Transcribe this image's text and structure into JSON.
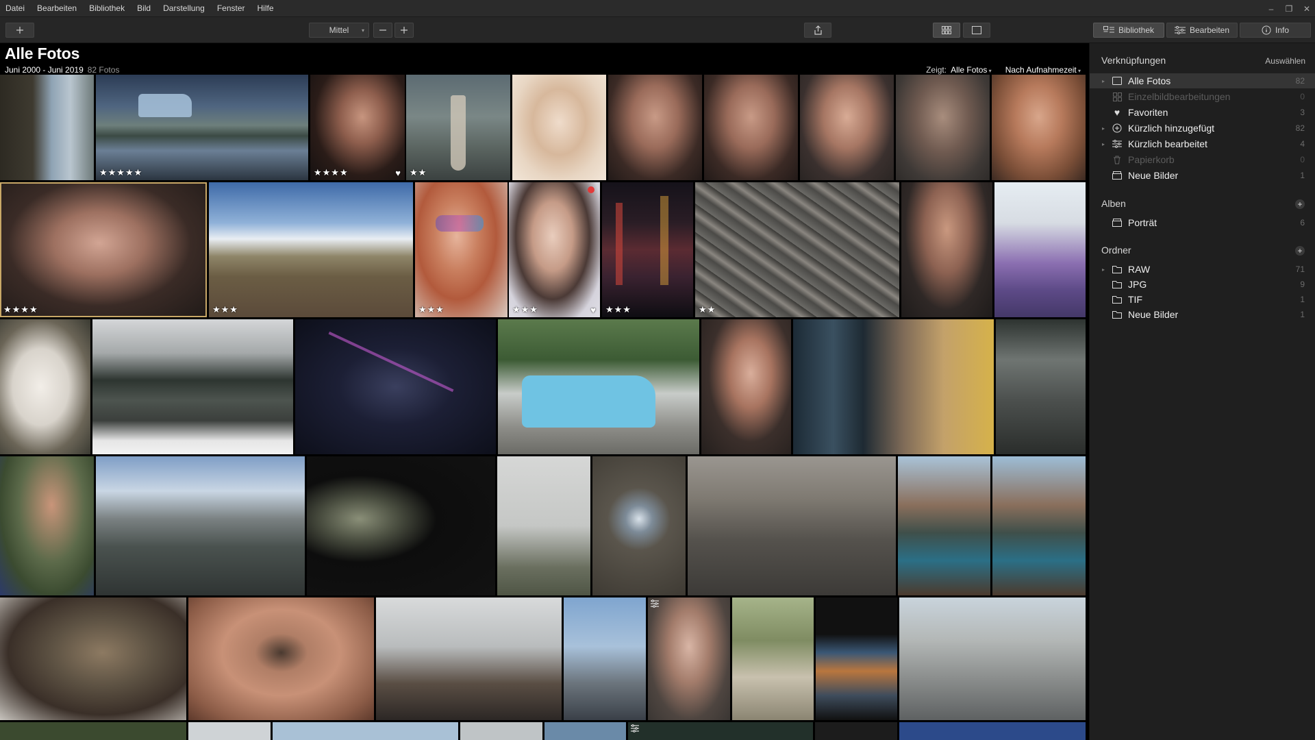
{
  "menu": [
    "Datei",
    "Bearbeiten",
    "Bibliothek",
    "Bild",
    "Darstellung",
    "Fenster",
    "Hilfe"
  ],
  "toolbar": {
    "size_select": "Mittel",
    "tab_library": "Bibliothek",
    "tab_edit": "Bearbeiten",
    "tab_info": "Info"
  },
  "header": {
    "title": "Alle Fotos",
    "date_range": "Juni 2000 - Juni 2019",
    "photo_count": "82 Fotos",
    "show_label": "Zeigt:",
    "show_value": "Alle Fotos",
    "sort_value": "Nach Aufnahmezeit"
  },
  "photos": [
    {
      "stars": "",
      "heart": false
    },
    {
      "stars": "★★★★★",
      "heart": false
    },
    {
      "stars": "★★★★",
      "heart": true
    },
    {
      "stars": "★★",
      "heart": false
    },
    {
      "stars": "",
      "heart": false
    },
    {
      "stars": "",
      "heart": false
    },
    {
      "stars": "",
      "heart": false
    },
    {
      "stars": "",
      "heart": false
    },
    {
      "stars": "",
      "heart": false
    },
    {
      "stars": "",
      "heart": false
    },
    {
      "stars": "★★★★",
      "heart": false
    },
    {
      "stars": "★★★",
      "heart": false
    },
    {
      "stars": "★★★",
      "heart": false
    },
    {
      "stars": "★★★",
      "heart": true
    },
    {
      "stars": "★★★",
      "heart": false
    },
    {
      "stars": "★★",
      "heart": false
    }
  ],
  "sidebar": {
    "shortcuts_title": "Verknüpfungen",
    "select_action": "Auswählen",
    "shortcuts": [
      {
        "label": "Alle Fotos",
        "count": "82"
      },
      {
        "label": "Einzelbildbearbeitungen",
        "count": "0"
      },
      {
        "label": "Favoriten",
        "count": "3"
      },
      {
        "label": "Kürzlich hinzugefügt",
        "count": "82"
      },
      {
        "label": "Kürzlich bearbeitet",
        "count": "4"
      },
      {
        "label": "Papierkorb",
        "count": "0"
      },
      {
        "label": "Neue Bilder",
        "count": "1"
      }
    ],
    "albums_title": "Alben",
    "albums": [
      {
        "label": "Porträt",
        "count": "6"
      }
    ],
    "folders_title": "Ordner",
    "folders": [
      {
        "label": "RAW",
        "count": "71"
      },
      {
        "label": "JPG",
        "count": "9"
      },
      {
        "label": "TIF",
        "count": "1"
      },
      {
        "label": "Neue Bilder",
        "count": "1"
      }
    ]
  },
  "colors": {
    "selection": "#c9a867",
    "panel_bg": "#1f1f1f",
    "toolbar_bg": "#262626",
    "menubar_bg": "#2b2b2b"
  }
}
